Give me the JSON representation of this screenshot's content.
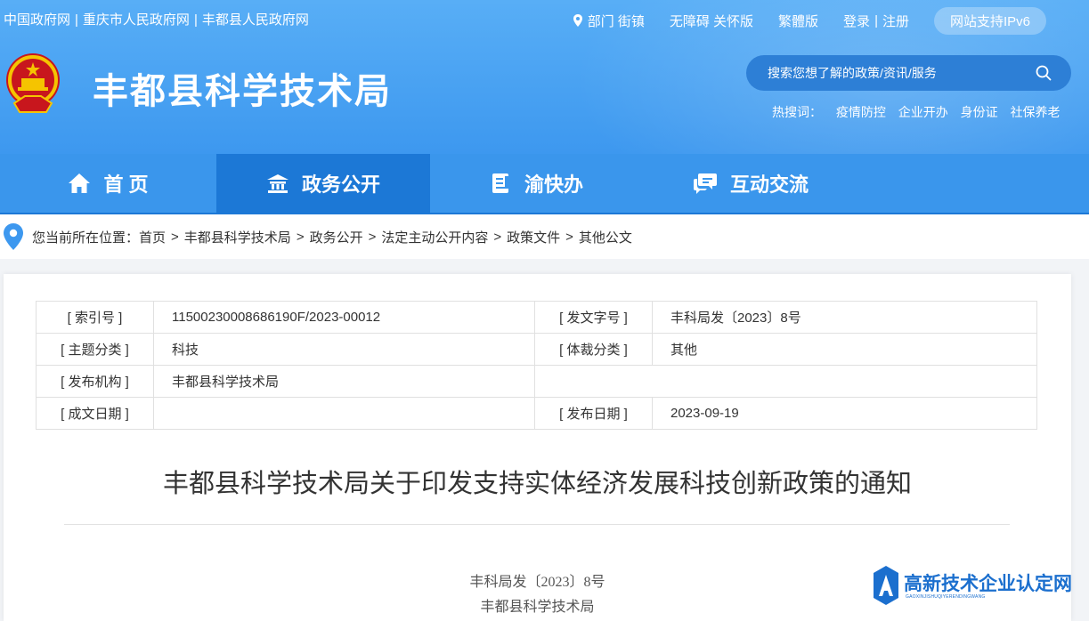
{
  "top_links": [
    "中国政府网",
    "重庆市人民政府网",
    "丰都县人民政府网"
  ],
  "top_right": {
    "dept": "部门 街镇",
    "accessible": "无障碍 关怀版",
    "traditional": "繁體版",
    "login": "登录",
    "register": "注册",
    "ipv6": "网站支持IPv6"
  },
  "site_title": "丰都县科学技术局",
  "search": {
    "placeholder": "搜索您想了解的政策/资讯/服务"
  },
  "hot": {
    "label": "热搜词：",
    "items": [
      "疫情防控",
      "企业开办",
      "身份证",
      "社保养老"
    ]
  },
  "nav": [
    {
      "label": "首 页",
      "icon": "home-icon"
    },
    {
      "label": "政务公开",
      "icon": "building-icon",
      "active": true
    },
    {
      "label": "渝快办",
      "icon": "document-icon"
    },
    {
      "label": "互动交流",
      "icon": "chat-icon"
    }
  ],
  "breadcrumb": {
    "prefix": "您当前所在位置：",
    "items": [
      "首页",
      "丰都县科学技术局",
      "政务公开",
      "法定主动公开内容",
      "政策文件",
      "其他公文"
    ],
    "separator": ">"
  },
  "meta": {
    "index_label": "[ 索引号 ]",
    "index_value": "11500230008686190F/2023-00012",
    "docno_label": "[ 发文字号 ]",
    "docno_value": "丰科局发〔2023〕8号",
    "topic_label": "[ 主题分类 ]",
    "topic_value": "科技",
    "genre_label": "[ 体裁分类 ]",
    "genre_value": "其他",
    "publisher_label": "[ 发布机构 ]",
    "publisher_value": "丰都县科学技术局",
    "created_label": "[ 成文日期 ]",
    "created_value": "",
    "pubdate_label": "[ 发布日期 ]",
    "pubdate_value": "2023-09-19"
  },
  "document": {
    "title": "丰都县科学技术局关于印发支持实体经济发展科技创新政策的通知",
    "number": "丰科局发〔2023〕8号",
    "org": "丰都县科学技术局"
  },
  "watermark": {
    "text": "高新技术企业认定网",
    "sub": "GAOXINJISHUQIYERENDINGWANG"
  },
  "colors": {
    "header": "#3d98ef",
    "nav": "#3a96ec",
    "nav_active": "#1c78d6",
    "search_bg": "#2d7fd6"
  }
}
